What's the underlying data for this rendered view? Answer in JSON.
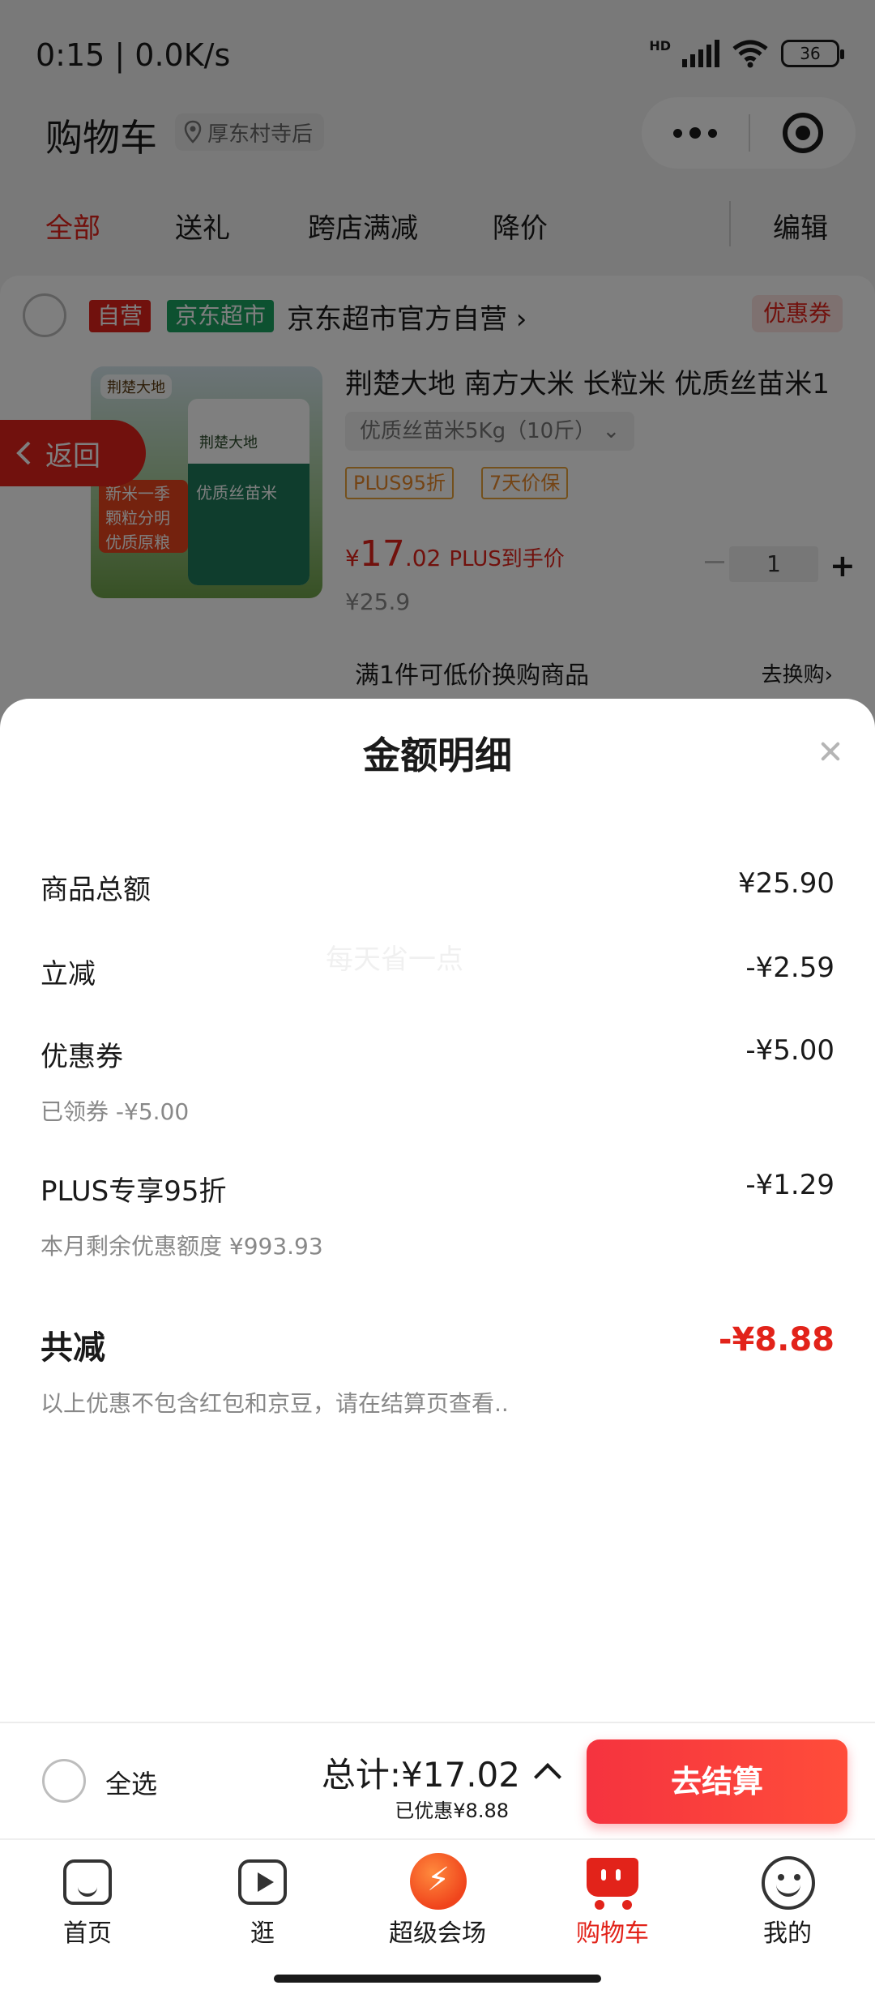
{
  "status_bar": {
    "time": "0:15 | 0.0K/s",
    "network": "HD",
    "battery": "36"
  },
  "header": {
    "title": "购物车",
    "location": "厚东村寺后"
  },
  "tabs": [
    {
      "label": "全部",
      "active": true
    },
    {
      "label": "送礼",
      "active": false
    },
    {
      "label": "跨店满减",
      "active": false
    },
    {
      "label": "降价",
      "active": false
    },
    {
      "label": "编辑",
      "active": false
    }
  ],
  "store": {
    "tag_self": "自营",
    "tag_market": "京东超市",
    "name": "京东超市官方自营 ›",
    "coupon": "优惠券"
  },
  "product": {
    "image_brand": "荆楚大地",
    "image_bag_text": "优质丝苗米",
    "image_badge": "新米一季 颗粒分明 优质原粮",
    "title": "荆楚大地 南方大米 长粒米 优质丝苗米1",
    "spec": "优质丝苗米5Kg（10斤） ⌄",
    "tags": [
      "PLUS95折",
      "7天价保"
    ],
    "price_currency": "¥",
    "price_int": "17",
    "price_dec": ".02",
    "price_label": "PLUS到手价",
    "price_old": "¥25.9",
    "quantity": "1",
    "promo": "满1件可低价换购商品",
    "promo_link": "去换购›"
  },
  "back_button": {
    "label": "返回"
  },
  "sheet": {
    "title": "金额明细",
    "watermark": "每天省一点",
    "rows": [
      {
        "label": "商品总额",
        "value": "¥25.90"
      },
      {
        "label": "立减",
        "value": "-¥2.59"
      },
      {
        "label": "优惠券",
        "value": "-¥5.00",
        "sub": "已领券 -¥5.00"
      },
      {
        "label": "PLUS专享95折",
        "value": "-¥1.29",
        "sub": "本月剩余优惠额度 ¥993.93"
      }
    ],
    "total_label": "共减",
    "total_value": "-¥8.88",
    "note": "以上优惠不包含红包和京豆，请在结算页查看.."
  },
  "checkout": {
    "select_all": "全选",
    "total": "总计:¥17.02",
    "saved": "已优惠¥8.88",
    "pay_button": "去结算"
  },
  "bottom_nav": [
    {
      "label": "首页",
      "icon": "home-icon"
    },
    {
      "label": "逛",
      "icon": "video-play-icon"
    },
    {
      "label": "超级会场",
      "icon": "mega-event-icon"
    },
    {
      "label": "购物车",
      "icon": "cart-icon",
      "active": true
    },
    {
      "label": "我的",
      "icon": "profile-icon"
    }
  ],
  "colors": {
    "brand_red": "#e2231a",
    "green": "#1aa260",
    "overlay": "rgba(0,0,0,0.5)"
  }
}
